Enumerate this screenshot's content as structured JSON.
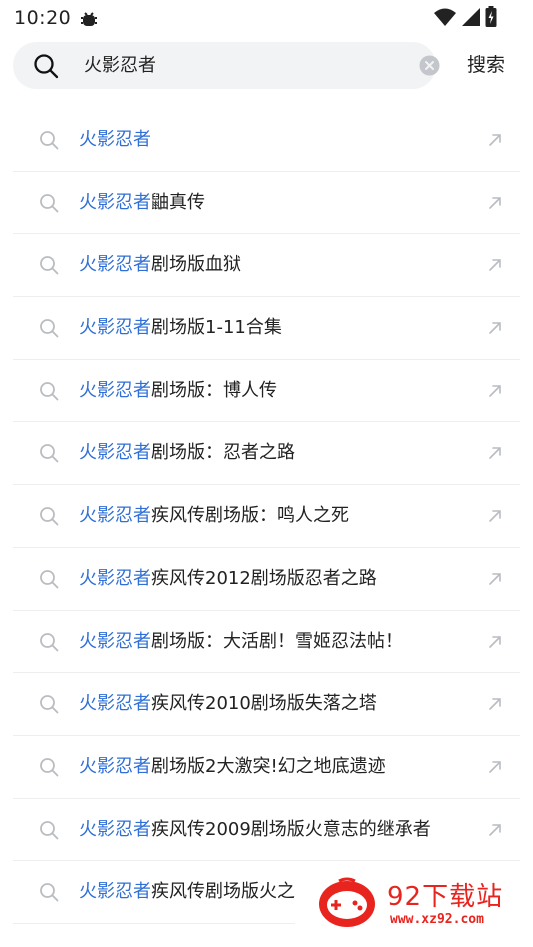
{
  "status_bar": {
    "time": "10:20"
  },
  "search": {
    "query": "火影忍者",
    "button_label": "搜索"
  },
  "suggestions": [
    {
      "highlight": "火影忍者",
      "rest": ""
    },
    {
      "highlight": "火影忍者",
      "rest": "鼬真传"
    },
    {
      "highlight": "火影忍者",
      "rest": "剧场版血狱"
    },
    {
      "highlight": "火影忍者",
      "rest": "剧场版1-11合集"
    },
    {
      "highlight": "火影忍者",
      "rest": "剧场版：博人传"
    },
    {
      "highlight": "火影忍者",
      "rest": "剧场版：忍者之路"
    },
    {
      "highlight": "火影忍者",
      "rest": "疾风传剧场版：鸣人之死"
    },
    {
      "highlight": "火影忍者",
      "rest": "疾风传2012剧场版忍者之路"
    },
    {
      "highlight": "火影忍者",
      "rest": "剧场版：大活剧！雪姬忍法帖！"
    },
    {
      "highlight": "火影忍者",
      "rest": "疾风传2010剧场版失落之塔"
    },
    {
      "highlight": "火影忍者",
      "rest": "剧场版2大激突!幻之地底遗迹"
    },
    {
      "highlight": "火影忍者",
      "rest": "疾风传2009剧场版火意志的继承者"
    },
    {
      "highlight": "火影忍者",
      "rest": "疾风传剧场版火之"
    }
  ],
  "watermark": {
    "title": "92下载站",
    "url": "www.xz92.com"
  },
  "colors": {
    "highlight": "#2f6fd6",
    "search_bg": "#f2f3f5",
    "watermark_red": "#e8241f"
  }
}
